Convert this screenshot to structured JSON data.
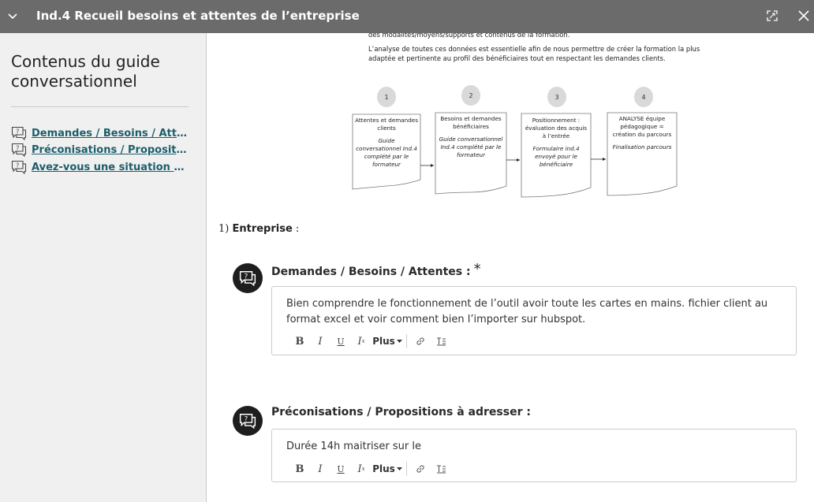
{
  "header": {
    "title": "Ind.4 Recueil besoins et attentes de l’entreprise"
  },
  "sidebar": {
    "title": "Contenus du guide conversationnel",
    "items": [
      {
        "label": "Demandes / Besoins / Attentes :"
      },
      {
        "label": "Préconisations / Propositions à adresser :"
      },
      {
        "label": "Avez-vous une situation de handicap ?"
      }
    ]
  },
  "document": {
    "line1": "des modalités/moyens/supports et contenus de la formation.",
    "line2": "L’analyse de toutes ces données est essentielle afin de nous permettre de créer la formation la plus",
    "line3": "adaptée et pertinente au profil des bénéficiaires tout en respectant les demandes clients.",
    "steps": [
      {
        "num": "1",
        "title": "Attentes et demandes clients",
        "detail": "Guide conversationnel Ind.4 complété par le formateur"
      },
      {
        "num": "2",
        "title": "Besoins et demandes bénéficiaires",
        "detail": "Guide conversationnel Ind.4 complété par le formateur"
      },
      {
        "num": "3",
        "title": "Positionnement : évaluation des acquis à l’entrée",
        "detail": "Formulaire ind.4 envoyé pour le bénéficiaire"
      },
      {
        "num": "4",
        "title": "ANALYSE équipe pédagogique = création du parcours",
        "detail": "Finalisation parcours"
      }
    ]
  },
  "section": {
    "prefix": "1)",
    "label": "Entreprise",
    "suffix": " :"
  },
  "questions": [
    {
      "title": "Demandes / Besoins / Attentes :",
      "required_mark": "*",
      "answer": "Bien comprendre le fonctionnement de l’outil avoir toute les cartes en mains. fichier client au format excel et voir comment bien l’importer sur hubspot."
    },
    {
      "title": "Préconisations / Propositions à adresser :",
      "answer": "Durée 14h maitriser sur le"
    }
  ],
  "toolbar": {
    "bold": "B",
    "italic": "I",
    "underline": "U",
    "clear": "I",
    "more": "Plus"
  }
}
